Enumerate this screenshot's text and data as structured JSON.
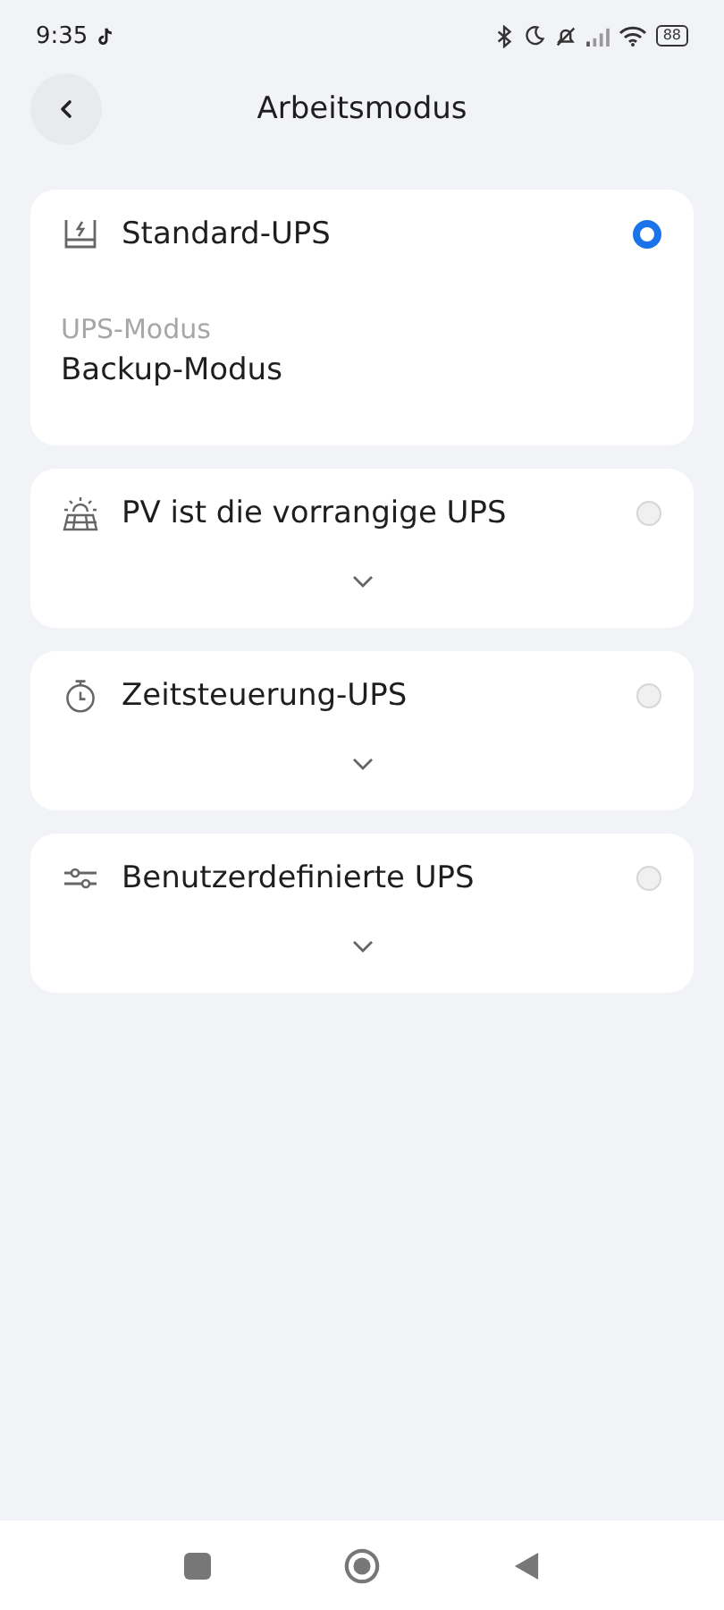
{
  "status_bar": {
    "time": "9:35",
    "battery": "88"
  },
  "header": {
    "title": "Arbeitsmodus"
  },
  "modes": [
    {
      "kind": "battery",
      "label": "Standard-UPS",
      "selected": true,
      "expanded": true,
      "details": [
        {
          "label": "UPS-Modus",
          "value": "Backup-Modus"
        }
      ]
    },
    {
      "kind": "solar",
      "label": "PV ist die vorrangige UPS",
      "selected": false,
      "expanded": false
    },
    {
      "kind": "timer",
      "label": "Zeitsteuerung-UPS",
      "selected": false,
      "expanded": false
    },
    {
      "kind": "sliders",
      "label": "Benutzerdefinierte UPS",
      "selected": false,
      "expanded": false
    }
  ]
}
